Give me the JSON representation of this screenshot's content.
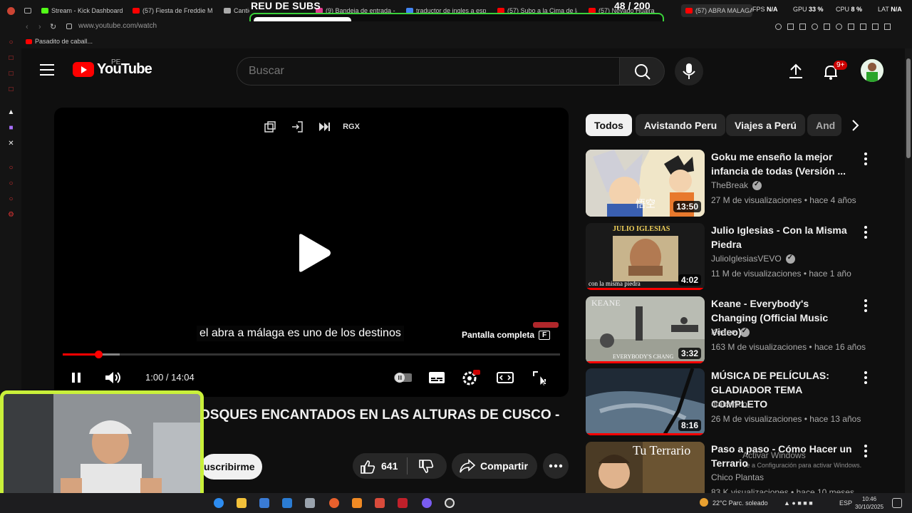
{
  "browser": {
    "tabs": [
      {
        "label": "Stream - Kick Dashboard",
        "color": "#53fc18"
      },
      {
        "label": "(57) Fiesta de Freddie Me",
        "color": "#ff0000"
      },
      {
        "label": "Cantidad permitida man",
        "color": "#aaaaaa"
      },
      {
        "label": "(9) Bandeja de entrada -",
        "color": "#e23c8f"
      },
      {
        "label": "traductor de ingles a esp",
        "color": "#4285f4"
      },
      {
        "label": "(57) Subo a la Cima de la",
        "color": "#ff0000"
      },
      {
        "label": "(57) Nevado Huaira",
        "color": "#ff0000"
      },
      {
        "label": "(57) ABRA MALAGA",
        "color": "#ff0000"
      }
    ],
    "url": "www.youtube.com/watch",
    "bookmark": "Pasadito de caball..."
  },
  "overlay": {
    "subgoal_title": "REU DE SUBS",
    "subgoal_count": "48  / 200",
    "subgoal_progress": 0.24,
    "fps_label": "FPS",
    "fps_value": "N/A",
    "gpu_label": "GPU",
    "gpu_value": "33 %",
    "cpu_label": "CPU",
    "cpu_value": "8 %",
    "lat_label": "LAT",
    "lat_value": "N/A"
  },
  "header": {
    "logo_text": "YouTube",
    "country": "PE",
    "search_placeholder": "Buscar",
    "notifications": "9+"
  },
  "player": {
    "caption": "el abra a málaga es uno de los destinos",
    "tooltip": "Pantalla completa",
    "tooltip_key": "F",
    "time": "1:00 / 14:04",
    "progress": 0.071,
    "buffered": 0.114,
    "top_label": "RGX"
  },
  "video": {
    "title": "OSQUES ENCANTADOS EN LAS ALTURAS DE CUSCO -",
    "subscribe": "uscribirme",
    "likes": "641",
    "share": "Compartir"
  },
  "chips": [
    "Todos",
    "Avistando Peru",
    "Viajes a Perú",
    "And"
  ],
  "recommendations": [
    {
      "title": "Goku me enseño la mejor infancia de todas (Versión ...",
      "channel": "TheBreak",
      "verified": true,
      "meta": "27 M de visualizaciones • hace 4 años",
      "duration": "13:50",
      "thumb_label": "悟空",
      "watched": 0
    },
    {
      "title": "Julio Iglesias - Con la Misma Piedra",
      "channel": "JulioIglesiasVEVO",
      "verified": true,
      "meta": "11 M de visualizaciones • hace 1 año",
      "duration": "4:02",
      "thumb_label": "JULIO IGLESIAS",
      "thumb_label2": "con la misma piedra",
      "watched": 1
    },
    {
      "title": "Keane - Everybody's Changing (Official Music Video)",
      "channel": "Keane",
      "verified": true,
      "meta": "163 M de visualizaciones • hace 16 años",
      "duration": "3:32",
      "thumb_label": "KEANE",
      "thumb_label2": "EVERYBODY'S CHANG",
      "watched": 1
    },
    {
      "title": "MÚSICA DE PELÍCULAS: GLADIADOR TEMA COMPLETO",
      "channel": "diaconico",
      "verified": false,
      "meta": "26 M de visualizaciones • hace 13 años",
      "duration": "8:16",
      "watched": 1
    },
    {
      "title": "Paso a paso - Cómo Hacer un Terrario",
      "channel": "Chico Plantas",
      "verified": false,
      "meta": "83 K visualizaciones • hace 10 meses",
      "duration": "",
      "thumb_label": "Tu Terrario",
      "watched": 0
    }
  ],
  "windows": {
    "activate_title": "Activar Windows",
    "activate_sub": "Ve a Configuración para activar Windows.",
    "weather": "22°C  Parc. soleado",
    "lang": "ESP",
    "time": "10:46",
    "date": "30/10/2025"
  }
}
